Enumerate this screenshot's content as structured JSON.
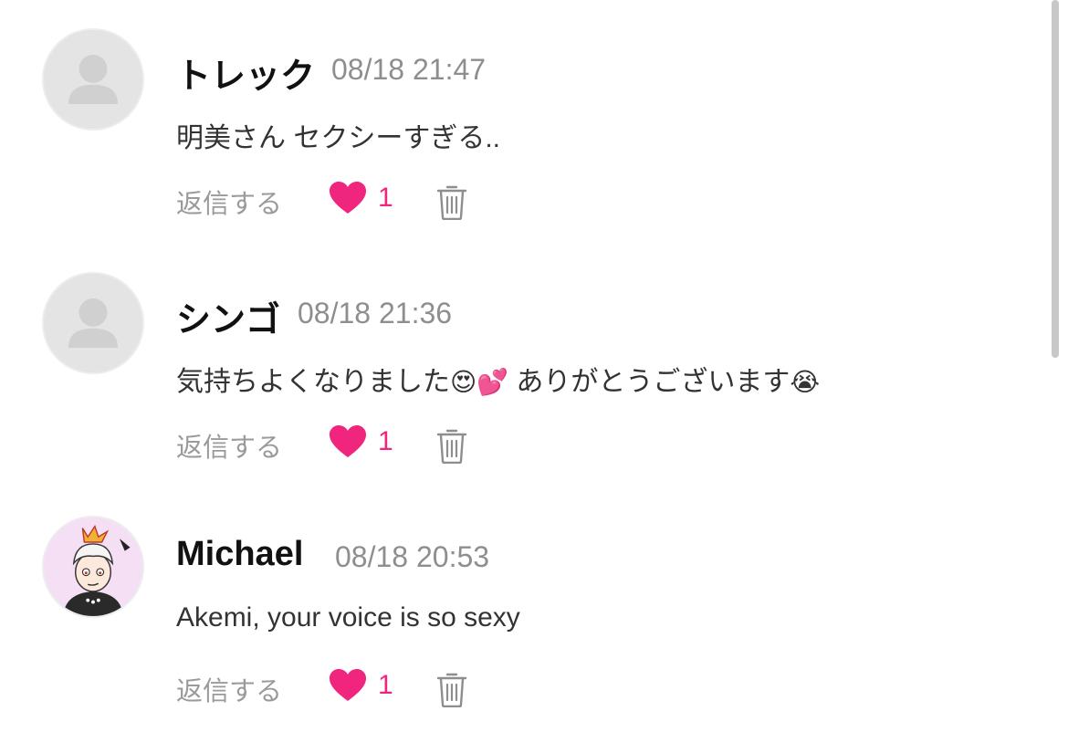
{
  "comments": [
    {
      "name": "トレック",
      "time": "08/18 21:47",
      "text": "明美さん セクシーすぎる..",
      "reply_label": "返信する",
      "likes": "1",
      "avatar": "default-person-icon"
    },
    {
      "name": "シンゴ",
      "time": "08/18 21:36",
      "text_parts": [
        "気持ちよくなりました",
        "😍",
        "💕",
        " ありがとうございます",
        "😭"
      ],
      "reply_label": "返信する",
      "likes": "1",
      "avatar": "default-person-icon"
    },
    {
      "name": "Michael",
      "time": "08/18 20:53",
      "text": "Akemi, your voice is so sexy",
      "reply_label": "返信する",
      "likes": "1",
      "avatar": "cartoon-character-avatar"
    }
  ],
  "colors": {
    "accent_heart": "#f0257e",
    "muted_text": "#8e8e8e",
    "name_text": "#111111"
  }
}
